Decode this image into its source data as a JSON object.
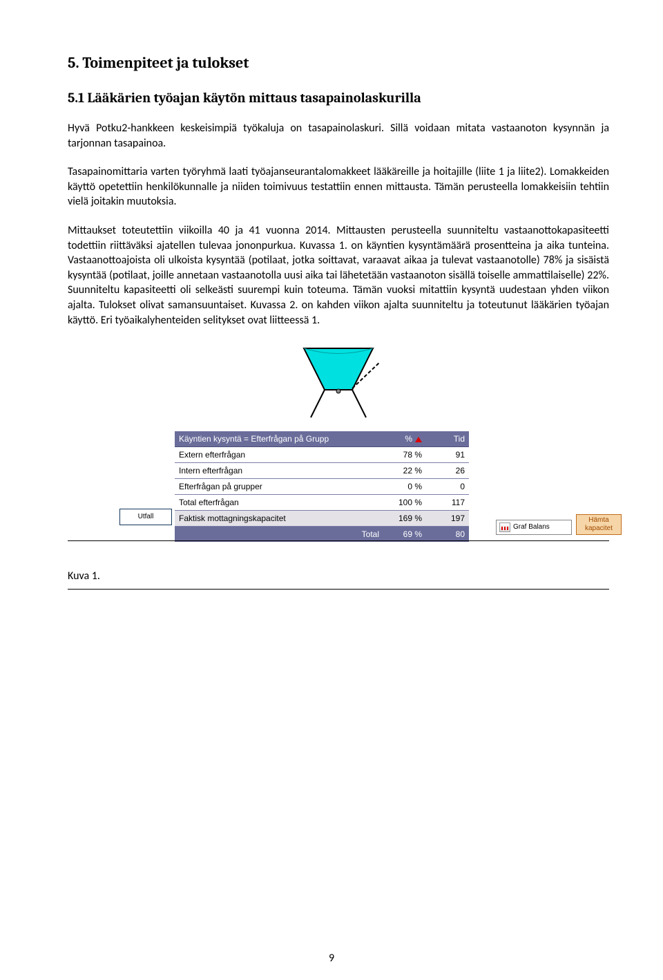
{
  "headings": {
    "h1": "5. Toimenpiteet ja tulokset",
    "h2": "5.1 Lääkärien työajan käytön mittaus tasapainolaskurilla"
  },
  "paragraphs": {
    "p1": "Hyvä Potku2-hankkeen keskeisimpiä työkaluja on tasapainolaskuri. Sillä voidaan mitata vastaanoton kysynnän ja tarjonnan tasapainoa.",
    "p2": "Tasapainomittaria varten työryhmä laati työajanseurantalomakkeet lääkäreille ja hoitajille (liite 1 ja liite2). Lomakkeiden käyttö opetettiin henkilökunnalle ja niiden toimivuus testattiin ennen mittausta.  Tämän perusteella lomakkeisiin tehtiin vielä joitakin muutoksia.",
    "p3": "Mittaukset toteutettiin viikoilla 40 ja 41 vuonna 2014. Mittausten perusteella suunniteltu vastaanottokapasiteetti todettiin riittäväksi ajatellen tulevaa jononpurkua. Kuvassa 1. on käyntien kysyntämäärä prosentteina ja aika tunteina. Vastaanottoajoista oli ulkoista kysyntää (potilaat, jotka soittavat, varaavat aikaa ja tulevat vastaanotolle) 78% ja sisäistä kysyntää (potilaat, joille annetaan vastaanotolla uusi aika tai lähetetään vastaanoton sisällä toiselle ammattilaiselle) 22%. Suunniteltu kapasiteetti oli selkeästi suurempi kuin toteuma. Tämän vuoksi mitattiin kysyntä uudestaan yhden viikon ajalta. Tulokset olivat samansuuntaiset. Kuvassa 2. on kahden viikon ajalta suunniteltu ja toteutunut lääkärien työajan käyttö. Eri työaikalyhenteiden selitykset ovat liitteessä 1."
  },
  "chart_data": {
    "type": "table",
    "title": "Käyntien kysyntä = Efterfrågan på Grupp",
    "columns": [
      "%",
      "Tid"
    ],
    "rows": [
      {
        "label": "Extern efterfrågan",
        "pct": "78 %",
        "tid": "91"
      },
      {
        "label": "Intern efterfrågan",
        "pct": "22 %",
        "tid": "26"
      },
      {
        "label": "Efterfrågan på grupper",
        "pct": "0 %",
        "tid": "0"
      },
      {
        "label": "Total efterfrågan",
        "pct": "100 %",
        "tid": "117"
      },
      {
        "label": "Faktisk mottagningskapacitet",
        "pct": "169 %",
        "tid": "197"
      }
    ],
    "footer": {
      "label": "Total",
      "pct": "69 %",
      "tid": "80"
    }
  },
  "buttons": {
    "utfall": "Utfall",
    "graf": "Graf Balans",
    "hamta_line1": "Hämta",
    "hamta_line2": "kapacitet"
  },
  "kuva": "Kuva 1.",
  "page_num": "9"
}
